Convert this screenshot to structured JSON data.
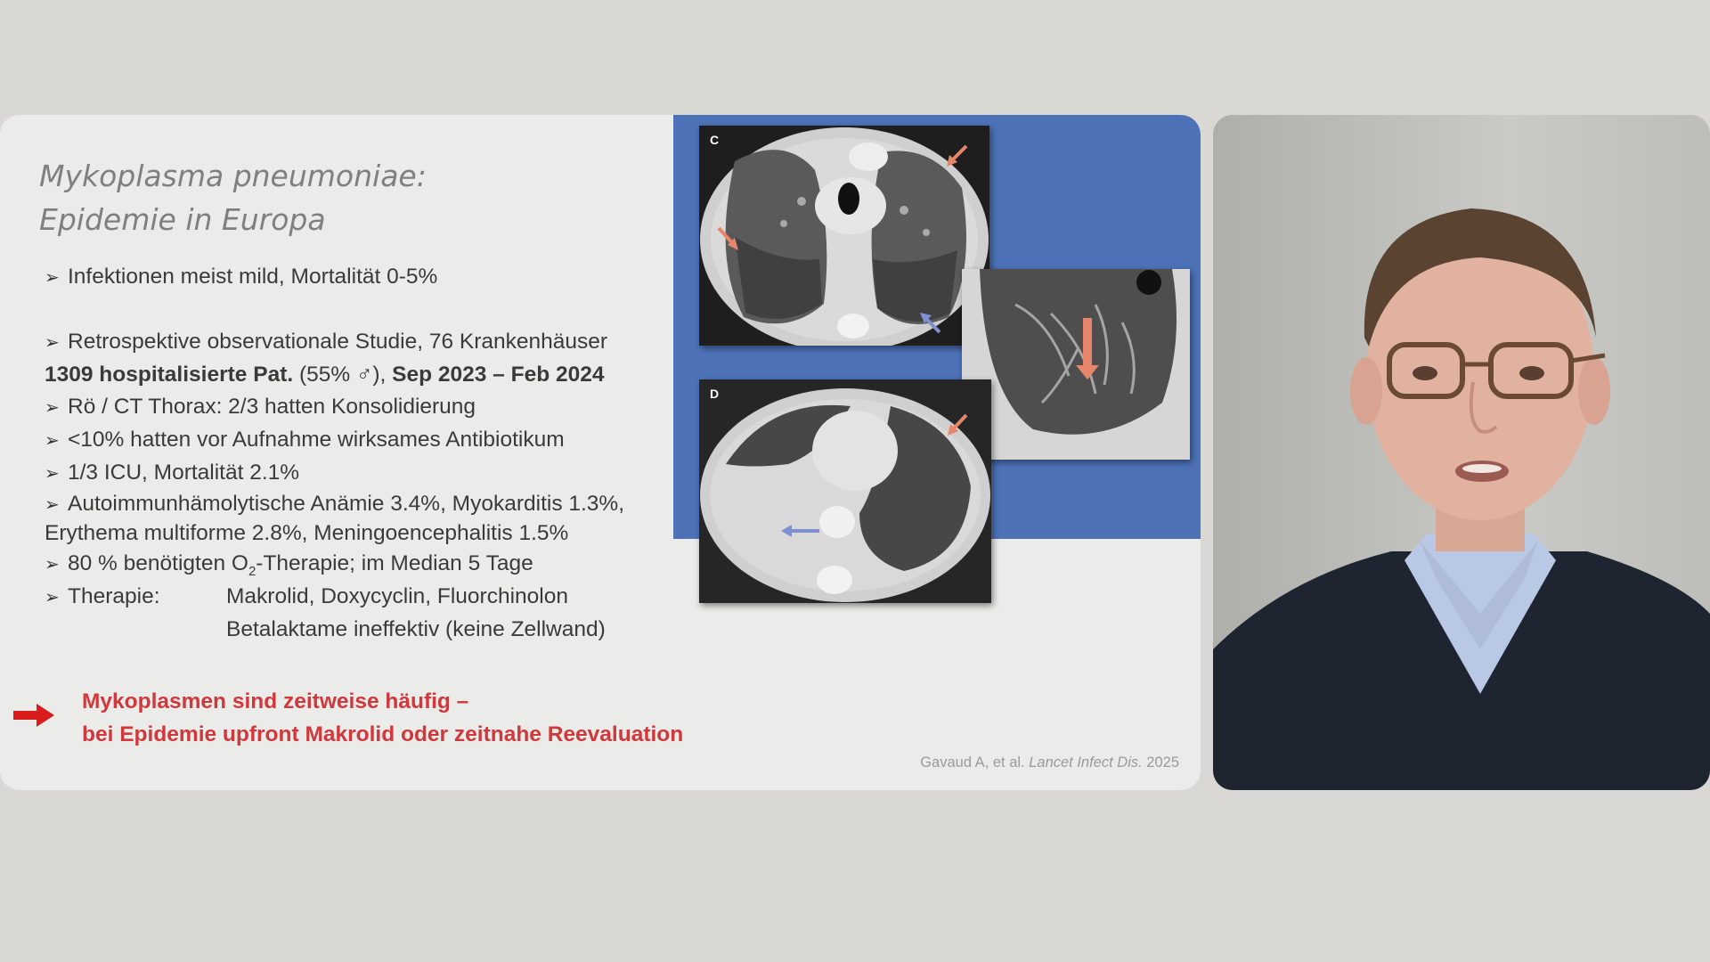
{
  "slide": {
    "title_line1": "Mykoplasma pneumoniae:",
    "title_line2": "Epidemie in Europa",
    "bullet1": "Infektionen meist mild, Mortalität 0-5%",
    "bullet2": "Retrospektive observationale Studie, 76 Krankenhäuser",
    "bullet2b_bold": "1309 hospitalisierte Pat.",
    "bullet2b_plain": " (55% ♂), ",
    "bullet2b_bold2": "Sep 2023 – Feb 2024",
    "bullet3": "Rö / CT Thorax: 2/3 hatten Konsolidierung",
    "bullet4": "<10% hatten vor Aufnahme wirksames Antibiotikum",
    "bullet5": "1/3 ICU, Mortalität 2.1%",
    "bullet6": "Autoimmunhämolytische Anämie 3.4%, Myokarditis 1.3%,",
    "bullet6b": "Erythema multiforme 2.8%, Meningoencephalitis 1.5%",
    "bullet7_pre": "80 % benötigten O",
    "bullet7_sub": "2",
    "bullet7_post": "-Therapie; im Median 5 Tage",
    "therapy_label": "Therapie:",
    "therapy_value1": "Makrolid, Doxycyclin, Fluorchinolon",
    "therapy_value2": "Betalaktame ineffektiv (keine Zellwand)",
    "takeaway_line1": "Mykoplasmen sind zeitweise häufig –",
    "takeaway_line2": "bei Epidemie upfront Makrolid oder zeitnahe Reevaluation",
    "citation_authors": "Gavaud A, et al. ",
    "citation_journal": "Lancet Infect Dis.",
    "citation_year": " 2025",
    "panel_c_label": "C",
    "panel_d_label": "D"
  },
  "colors": {
    "background": "#d9d8d4",
    "slide_bg": "#ebebea",
    "title_gray": "#7f7f7f",
    "accent_red": "#d0383b",
    "panel_blue": "#4d72b8"
  },
  "icons": {
    "bullet": "arrowhead-bullet-icon",
    "takeaway": "red-arrow-icon"
  }
}
